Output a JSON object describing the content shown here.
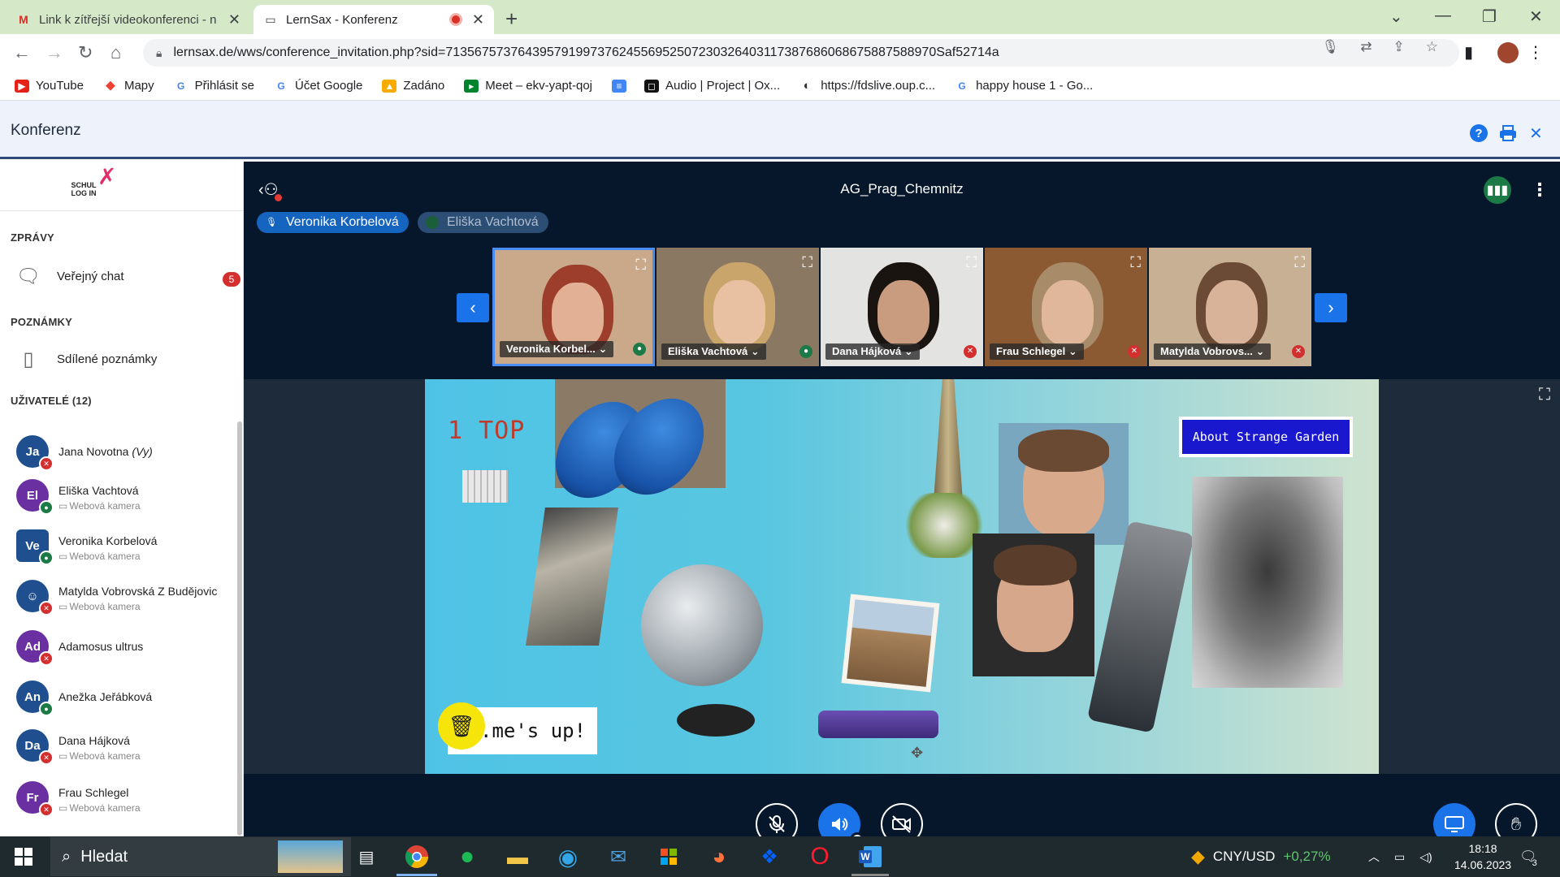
{
  "browser": {
    "tabs": [
      {
        "title": "Link k zítřejší videokonferenci - n",
        "active": false
      },
      {
        "title": "LernSax - Konferenz",
        "active": true
      }
    ],
    "url": "lernsax.de/wws/conference_invitation.php?sid=71356757376439579199737624556952507230326403117387686068675887588970Saf52714a",
    "bookmarks": [
      {
        "label": "YouTube",
        "icon": "youtube-icon"
      },
      {
        "label": "Mapy",
        "icon": "maps-icon"
      },
      {
        "label": "Přihlásit se",
        "icon": "google-icon"
      },
      {
        "label": "Účet Google",
        "icon": "google-icon"
      },
      {
        "label": "Zadáno",
        "icon": "classroom-icon"
      },
      {
        "label": "Meet – ekv-yapt-qoj",
        "icon": "meet-icon"
      },
      {
        "label": "",
        "icon": "docs-icon"
      },
      {
        "label": "Audio | Project | Ox...",
        "icon": "oxford-icon"
      },
      {
        "label": "https://fdslive.oup.c...",
        "icon": "globe-icon"
      },
      {
        "label": "happy house 1 - Go...",
        "icon": "google-icon"
      }
    ]
  },
  "app": {
    "header_title": "Konferenz",
    "logo": "SCHUL LOG IN"
  },
  "sidebar": {
    "messages_section": "ZPRÁVY",
    "public_chat": "Veřejný chat",
    "public_chat_badge": "5",
    "notes_section": "POZNÁMKY",
    "shared_notes": "Sdílené poznámky",
    "users_section": "UŽIVATELÉ (12)",
    "users": [
      {
        "initials": "Ja",
        "name": "Jana Novotna",
        "you": "(Vy)",
        "sub": "",
        "color": "#1f4f8f",
        "status": "muted"
      },
      {
        "initials": "El",
        "name": "Eliška Vachtová",
        "sub": "Webová kamera",
        "color": "#6a2fa0",
        "status": "unmuted"
      },
      {
        "initials": "Ve",
        "name": "Veronika Korbelová",
        "sub": "Webová kamera",
        "color": "#1f4f8f",
        "status": "unmuted"
      },
      {
        "initials": "☺",
        "name": "Matylda Vobrovská Z Budějovic",
        "sub": "Webová kamera",
        "color": "#1f4f8f",
        "status": "muted"
      },
      {
        "initials": "Ad",
        "name": "Adamosus ultrus",
        "sub": "",
        "color": "#6a2fa0",
        "status": "muted"
      },
      {
        "initials": "An",
        "name": "Anežka Jeřábková",
        "sub": "",
        "color": "#1f4f8f",
        "status": "unmuted"
      },
      {
        "initials": "Da",
        "name": "Dana Hájková",
        "sub": "Webová kamera",
        "color": "#1f4f8f",
        "status": "muted"
      },
      {
        "initials": "Fr",
        "name": "Frau Schlegel",
        "sub": "Webová kamera",
        "color": "#6a2fa0",
        "status": "muted"
      }
    ]
  },
  "conference": {
    "room_name": "AG_Prag_Chemnitz",
    "talkers": [
      "Veronika Korbelová",
      "Eliška Vachtová"
    ],
    "tiles": [
      {
        "name": "Veronika Korbel...",
        "status": "unmuted",
        "bg": "#c9a98a",
        "face": "#e2b095",
        "hair": "#9c3e2b"
      },
      {
        "name": "Eliška Vachtová",
        "status": "unmuted",
        "bg": "#8a7862",
        "face": "#e8c1a3",
        "hair": "#c9a56b"
      },
      {
        "name": "Dana Hájková",
        "status": "muted",
        "bg": "#e3e3e1",
        "face": "#c99c80",
        "hair": "#1a1410"
      },
      {
        "name": "Frau Schlegel",
        "status": "muted",
        "bg": "#8b5a32",
        "face": "#e0b79b",
        "hair": "#a88c6a"
      },
      {
        "name": "Matylda Vobrovs...",
        "status": "muted",
        "bg": "#c8b094",
        "face": "#d8b39a",
        "hair": "#6b4b35"
      }
    ],
    "slide": {
      "top_label": "1 TOP",
      "button": "About Strange Garden",
      "timer_label": ".me's up!"
    }
  },
  "taskbar": {
    "search": "Hledat",
    "ticker": "CNY/USD",
    "ticker_change": "+0,27%",
    "time": "18:18",
    "date": "14.06.2023",
    "notifications": "3"
  }
}
